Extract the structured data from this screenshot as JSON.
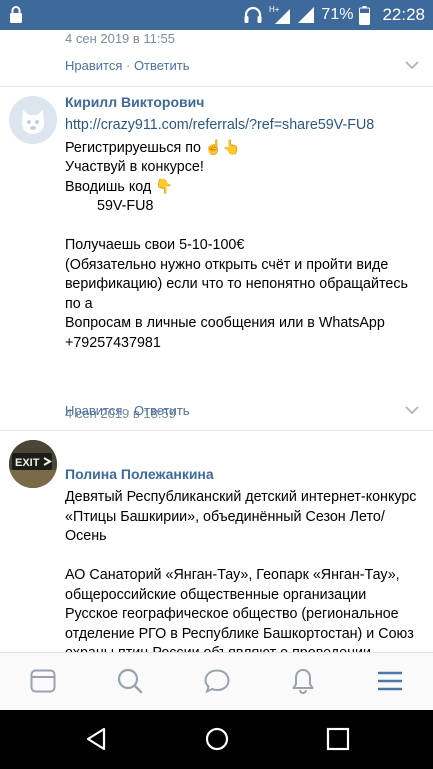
{
  "status_bar": {
    "battery_percent": "71%",
    "time": "22:28",
    "network": "H+"
  },
  "top_comment": {
    "time": "4 сен 2019 в 11:55",
    "like_label": "Нравится",
    "separator": " · ",
    "reply_label": "Ответить"
  },
  "comments": [
    {
      "author": "Кирилл Викторович",
      "link": "http://crazy911.com/referrals/?ref=share59V-FU8",
      "lines": [
        "Регистрируешься по",
        "Участвуй в конкурсе!",
        "Вводишь код",
        "59V-FU8",
        "",
        "Получаешь свои 5-10-100€",
        "(Обязательно нужно открыть счёт и пройти виде верификацию) если что то непонятно обращайтесь по а",
        "Вопросам в личные сообщения или в WhatsApp",
        "+79257437981"
      ],
      "time": "4 сен 2019 в 18:59",
      "like_label": "Нравится",
      "separator": " · ",
      "reply_label": "Ответить",
      "emoji_pointing": "☝👆",
      "emoji_down": "👇"
    },
    {
      "author": "Полина Полежанкина",
      "avatar_text": "EXIT",
      "paragraph1": "Девятый Республиканский детский интернет-конкурс «Птицы Башкирии», объединённый Сезон Лето/Осень",
      "paragraph2": "АО Санаторий «Янган-Тау», Геопарк «Янган-Тау», общероссийские общественные организации Русское географическое общество (региональное отделение РГО в Республике Башкортостан) и Союз охраны птиц России объявляют о проведении"
    }
  ],
  "tabs": [
    "news-tab",
    "search-tab",
    "messages-tab",
    "notifications-tab",
    "menu-tab"
  ]
}
